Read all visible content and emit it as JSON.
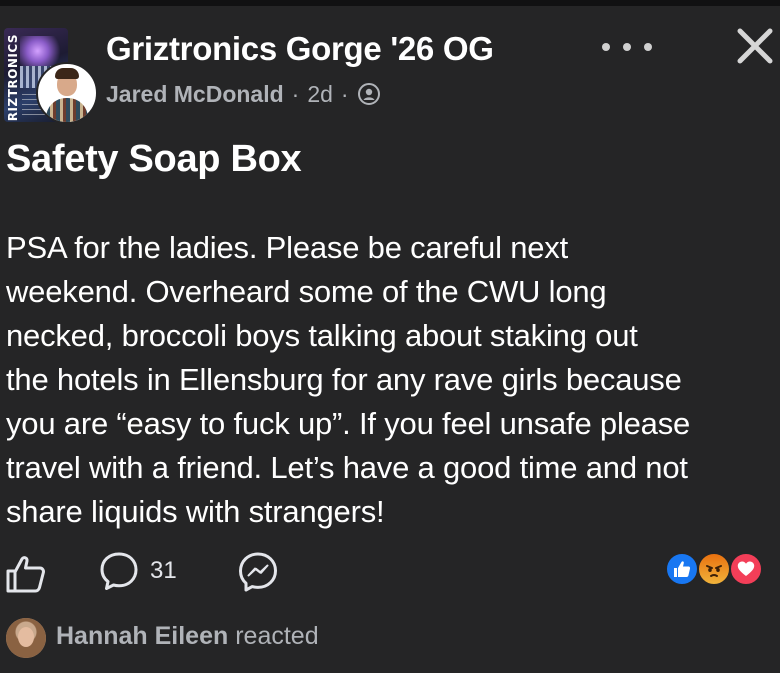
{
  "header": {
    "group_name": "Griztronics Gorge '26 OG",
    "group_cover_text": "GRIZTRONICS",
    "author_name": "Jared McDonald",
    "separator": "·",
    "time_ago": "2d",
    "audience_icon": "group-members-icon"
  },
  "post": {
    "title": "Safety Soap Box",
    "body_lines": [
      "PSA for the ladies. Please be careful next",
      "weekend. Overheard some of the CWU long",
      "necked, broccoli boys talking about staking out",
      "the hotels in Ellensburg for any rave girls because",
      "you are “easy to fuck up”. If you feel unsafe please",
      "travel with a friend. Let’s have a good time and not",
      "share liquids with strangers!"
    ]
  },
  "actions": {
    "comment_count": "31",
    "reactions": [
      "like",
      "angry",
      "love"
    ]
  },
  "reacted": {
    "name": "Hannah Eileen",
    "suffix": "reacted"
  },
  "colors": {
    "background": "#252526",
    "text_primary": "#ffffff",
    "text_secondary": "#b0b3b8",
    "like_blue": "#1877f2",
    "love_red": "#f33e58",
    "angry_orange": "#e9710f"
  }
}
